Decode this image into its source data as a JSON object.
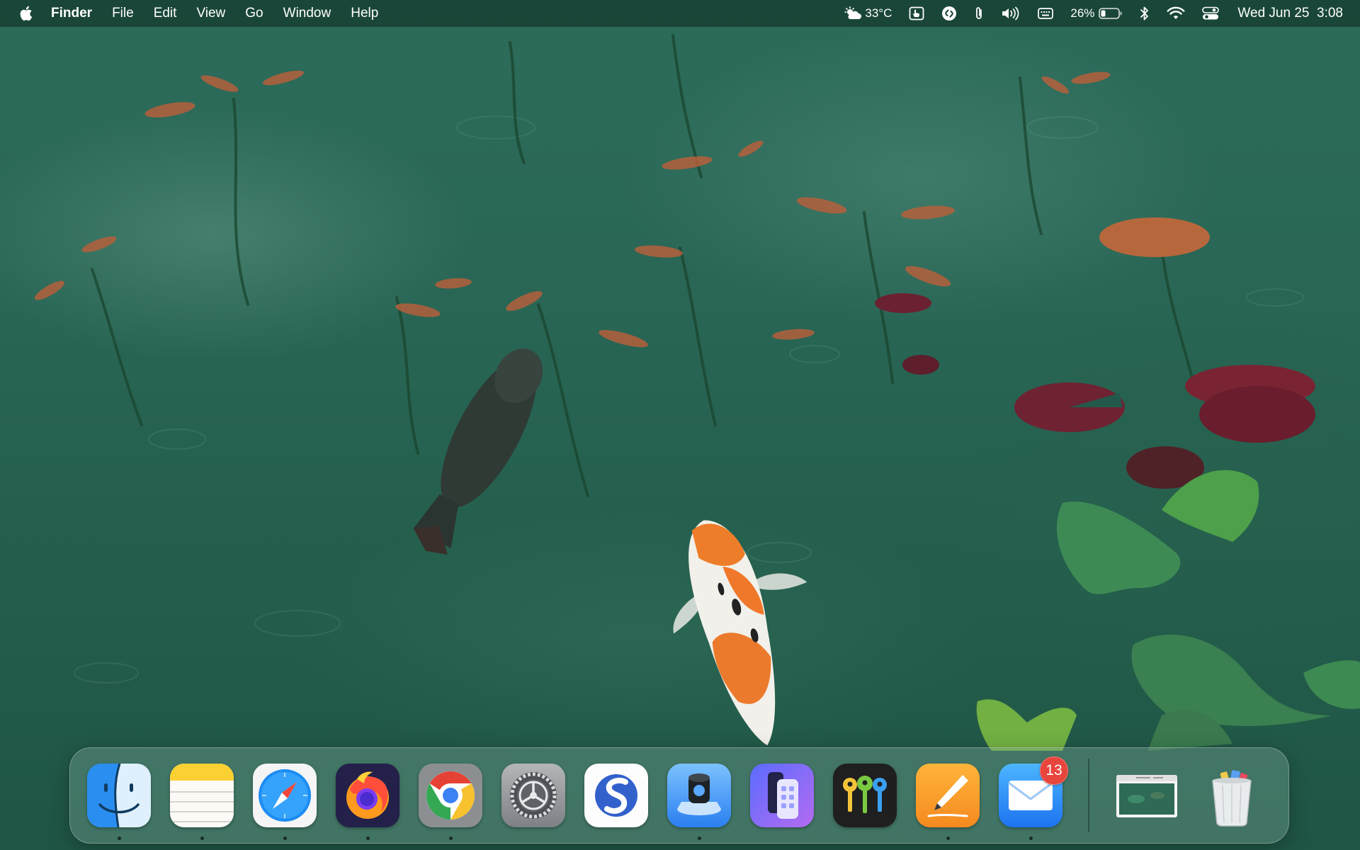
{
  "menubar": {
    "apple_icon": "apple-logo-icon",
    "menus": [
      {
        "label": "Finder",
        "bold": true
      },
      {
        "label": "File"
      },
      {
        "label": "Edit"
      },
      {
        "label": "View"
      },
      {
        "label": "Go"
      },
      {
        "label": "Window"
      },
      {
        "label": "Help"
      }
    ],
    "status": {
      "weather_icon": "partly-cloudy-icon",
      "weather_text": "33°C",
      "battery_percent": "26%",
      "battery_level": 0.26,
      "clock": "Wed Jun 25  3:08"
    }
  },
  "dock": {
    "apps": [
      {
        "name": "Finder",
        "icon": "finder-icon",
        "running": true
      },
      {
        "name": "Notes",
        "icon": "notes-icon",
        "running": true
      },
      {
        "name": "Safari",
        "icon": "safari-icon",
        "running": true
      },
      {
        "name": "Firefox",
        "icon": "firefox-icon",
        "running": true
      },
      {
        "name": "Chrome",
        "icon": "chrome-icon",
        "running": true
      },
      {
        "name": "System Settings",
        "icon": "settings-gear-icon",
        "running": false
      },
      {
        "name": "Simplenote",
        "icon": "simplenote-icon",
        "running": false
      },
      {
        "name": "Preview",
        "icon": "preview-lens-icon",
        "running": true
      },
      {
        "name": "iPhone Mirroring",
        "icon": "phone-mirroring-icon",
        "running": false
      },
      {
        "name": "Passwords",
        "icon": "passwords-keys-icon",
        "running": false
      },
      {
        "name": "Pages",
        "icon": "pages-pen-icon",
        "running": true
      },
      {
        "name": "Mail",
        "icon": "mail-envelope-icon",
        "running": true,
        "badge": "13"
      }
    ],
    "minimized": {
      "name": "Minimized window",
      "icon": "window-thumbnail-icon"
    },
    "trash": {
      "name": "Trash",
      "icon": "trash-full-icon"
    }
  },
  "colors": {
    "menubar_bg": "#163c30",
    "water": "#2a6756",
    "badge": "#e8453c"
  }
}
